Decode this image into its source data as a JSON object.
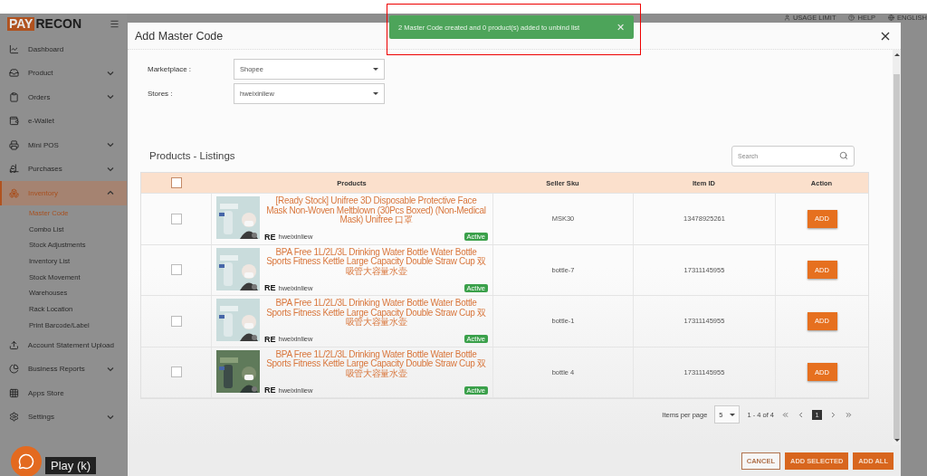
{
  "logo": {
    "part_1": "PAY",
    "part_2": "RECON"
  },
  "header": {
    "items": [
      "USAGE LIMIT",
      "HELP",
      "ENGLISH"
    ]
  },
  "sidebar": {
    "items": [
      {
        "label": "Dashboard",
        "selected": false
      },
      {
        "label": "Product",
        "expanded": false,
        "selected": false
      },
      {
        "label": "Orders",
        "expanded": false,
        "selected": false
      },
      {
        "label": "e-Wallet",
        "selected": false
      },
      {
        "label": "Mini POS",
        "expanded": false,
        "selected": false
      },
      {
        "label": "Purchases",
        "expanded": false,
        "selected": false
      },
      {
        "label": "Inventory",
        "expanded": true,
        "selected": true,
        "children": [
          {
            "label": "Master Code",
            "selected": true
          },
          {
            "label": "Combo List",
            "selected": false
          },
          {
            "label": "Stock Adjustments",
            "selected": false
          },
          {
            "label": "Inventory List",
            "selected": false
          },
          {
            "label": "Stock Movement",
            "selected": false
          },
          {
            "label": "Warehouses",
            "selected": false
          },
          {
            "label": "Rack Location",
            "selected": false
          },
          {
            "label": "Print Barcode/Label",
            "selected": false
          }
        ]
      },
      {
        "label": "Account Statement Upload",
        "selected": false
      },
      {
        "label": "Business Reports",
        "expanded": false,
        "selected": false
      },
      {
        "label": "Apps Store",
        "selected": false
      },
      {
        "label": "Settings",
        "expanded": false,
        "selected": false
      }
    ]
  },
  "toast": {
    "message": "2 Master Code created and 0 product(s) added to unbind list",
    "close": "✕"
  },
  "dialog": {
    "title": "Add Master Code",
    "fields": [
      {
        "label": "Marketplace :",
        "value": "Shopee"
      },
      {
        "label": "Stores :",
        "value": "hweixinliew"
      }
    ],
    "listings_title": "Products - Listings",
    "search": {
      "placeholder": "Search"
    },
    "table": {
      "columns": [
        "Products",
        "Seller Sku",
        "Item ID",
        "Action"
      ],
      "header_checked": false,
      "rows": [
        {
          "checked": false,
          "title": "[Ready Stock] Unifree 3D Disposable Protective Face Mask Non-Woven Meltblown (30Pcs Boxed) (Non-Medical Mask) Unifree 口罩",
          "store_mark": "RE",
          "store": "hweixinliew",
          "status": "Active",
          "sku": "MSK30",
          "item_id": "13478925261",
          "action": "ADD"
        },
        {
          "checked": false,
          "title": "BPA Free 1L/2L/3L Drinking Water Bottle Water Bottle Sports Fitness Kettle Large Capacity Double Straw Cup 双吸管大容量水壶",
          "store_mark": "RE",
          "store": "hweixinliew",
          "status": "Active",
          "sku": "bottle-7",
          "item_id": "17311145955",
          "action": "ADD"
        },
        {
          "checked": false,
          "title": "BPA Free 1L/2L/3L Drinking Water Bottle Water Bottle Sports Fitness Kettle Large Capacity Double Straw Cup 双吸管大容量水壶",
          "store_mark": "RE",
          "store": "hweixinliew",
          "status": "Active",
          "sku": "bottle-1",
          "item_id": "17311145955",
          "action": "ADD"
        },
        {
          "checked": false,
          "title": "BPA Free 1L/2L/3L Drinking Water Bottle Water Bottle Sports Fitness Kettle Large Capacity Double Straw Cup 双吸管大容量水壶",
          "store_mark": "RE",
          "store": "hweixinliew",
          "status": "Active",
          "sku": "bottle 4",
          "item_id": "17311145955",
          "action": "ADD"
        }
      ]
    },
    "pagination": {
      "label": "Items per page",
      "per_page": "5",
      "range": "1 - 4 of 4",
      "pages": [
        {
          "label": "1",
          "selected": true
        }
      ]
    },
    "buttons": [
      {
        "label": "CANCEL",
        "kind": "outline"
      },
      {
        "label": "ADD SELECTED",
        "kind": "filled"
      },
      {
        "label": "ADD ALL",
        "kind": "filled"
      }
    ]
  },
  "tooltip": {
    "text": "Play (k)"
  }
}
